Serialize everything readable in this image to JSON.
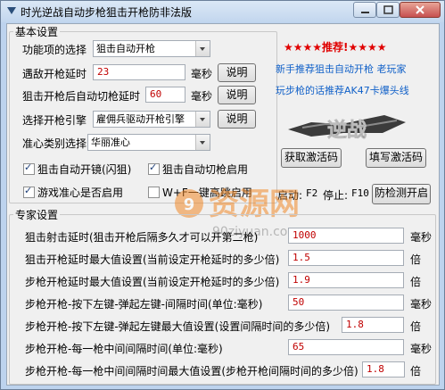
{
  "window": {
    "title": "时光逆战自动步枪狙击开枪防非法版"
  },
  "basic": {
    "legend": "基本设置",
    "function_label": "功能项的选择",
    "function_value": "狙击自动开枪",
    "delay_label": "遇敌开枪延时",
    "delay_value": "23",
    "delay_unit": "毫秒",
    "explain1": "说明",
    "switch_label": "狙击开枪后自动切枪延时",
    "switch_value": "60",
    "switch_unit": "毫秒",
    "explain2": "说明",
    "engine_label": "选择开枪引擎",
    "engine_value": "雇佣兵驱动开枪引擎",
    "explain3": "说明",
    "crosshair_label": "准心类别选择",
    "crosshair_value": "华丽准心",
    "chk1": "狙击自动开镜(闪狙)",
    "chk2": "狙击自动切枪启用",
    "chk3": "游戏准心是否启用",
    "chk4": "W+F一键高跳启用"
  },
  "promo": {
    "stars": "★★★★推荐!★★★★",
    "line1": "新手推荐狙击自动开枪 老玩家",
    "line2": "玩步枪的话推荐AK47卡爆头线",
    "logo_text": "逆战",
    "get_code": "获取激活码",
    "fill_code": "填写激活码",
    "start_label": "启动:",
    "start_key": "F2",
    "stop_label": "停止:",
    "stop_key": "F10",
    "anti_detect": "防检测开启"
  },
  "watermark": {
    "text": "资源网",
    "url": "90ziyuan.com"
  },
  "expert": {
    "legend": "专家设置",
    "rows": [
      {
        "label": "狙击射击延时(狙击开枪后隔多久才可以开第二枪)",
        "value": "1000",
        "unit": "毫秒"
      },
      {
        "label": "狙击开枪延时最大值设置(当前设定开枪延时的多少倍)",
        "value": "1.5",
        "unit": "倍"
      },
      {
        "label": "步枪开枪延时最大值设置(当前设定开枪延时的多少倍)",
        "value": "1.9",
        "unit": "倍"
      },
      {
        "label": "步枪开枪-按下左键-弹起左键-间隔时间(单位:毫秒)",
        "value": "50",
        "unit": "毫秒"
      },
      {
        "label": "步枪开枪-按下左键-弹起左键最大值设置(设置间隔时间的多少倍)",
        "value": "1.8",
        "unit": "倍"
      },
      {
        "label": "步枪开枪-每一枪中间间隔时间(单位:毫秒)",
        "value": "65",
        "unit": "毫秒"
      },
      {
        "label": "步枪开枪-每一枪中间间隔时间最大值设置(步枪开枪间隔时间的多少倍)",
        "value": "1.8",
        "unit": "倍"
      }
    ]
  },
  "colors": {
    "value_text": "#c00000",
    "promo_text": "#1060c8",
    "stars": "#e00000"
  }
}
